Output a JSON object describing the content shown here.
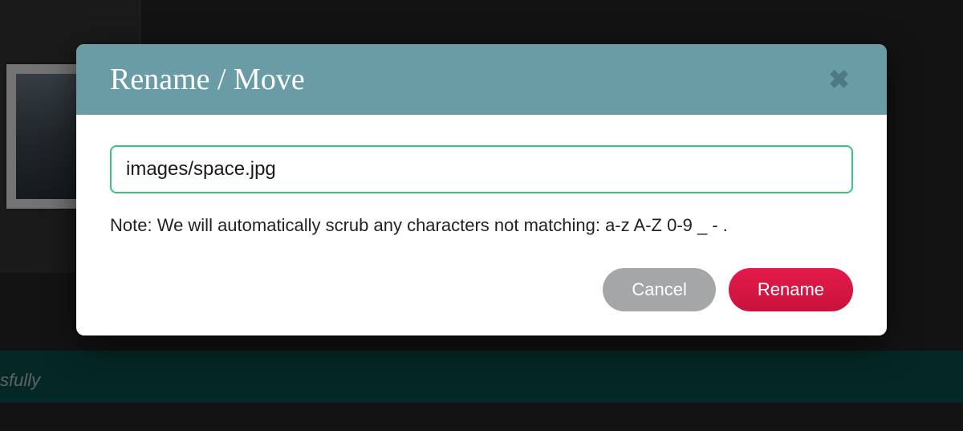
{
  "modal": {
    "title": "Rename / Move",
    "input_value": "images/space.jpg",
    "note": "Note: We will automatically scrub any characters not matching: a-z A-Z 0-9 _ - .",
    "cancel_label": "Cancel",
    "confirm_label": "Rename"
  },
  "backdrop": {
    "band_text_fragment": "sfully"
  }
}
